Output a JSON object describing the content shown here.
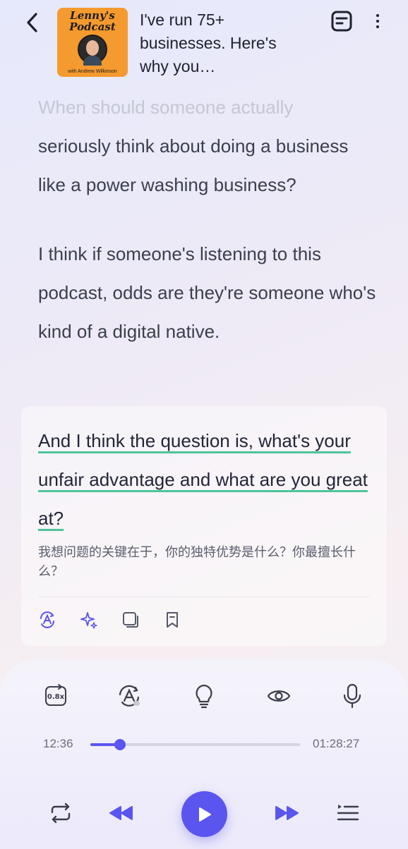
{
  "header": {
    "back_icon": "chevron-left-icon",
    "cover": {
      "logo_line1": "Lenny's",
      "logo_line2": "Podcast",
      "guest": "with Andrew Wilkinson"
    },
    "title": "I've run 75+ businesses. Here's why you…",
    "transcript_icon": "transcript-icon",
    "more_icon": "more-vertical-icon"
  },
  "transcript": {
    "faded_line": "When should someone actually",
    "para1": "seriously think about doing a business like a power washing business?",
    "para2": "I think if someone's listening to this podcast, odds are they're someone who's kind of a digital native.",
    "active": {
      "text": "And I think the question is, what's your unfair advantage and what are you great at?",
      "translation": "我想问题的关键在于，你的独特优势是什么？你最擅长什么？"
    },
    "card_actions": [
      "translate-icon",
      "sparkle-icon",
      "copy-icon",
      "bookmark-icon"
    ]
  },
  "player": {
    "speed": "0.8x",
    "tools": [
      "speed-icon",
      "auto-translate-icon",
      "lightbulb-icon",
      "eye-icon",
      "microphone-icon"
    ],
    "current_time": "12:36",
    "total_time": "01:28:27",
    "progress": 0.142,
    "controls": [
      "repeat-icon",
      "rewind-icon",
      "play-icon",
      "fast-forward-icon",
      "playlist-icon"
    ],
    "accent_color": "#5a55ee"
  }
}
